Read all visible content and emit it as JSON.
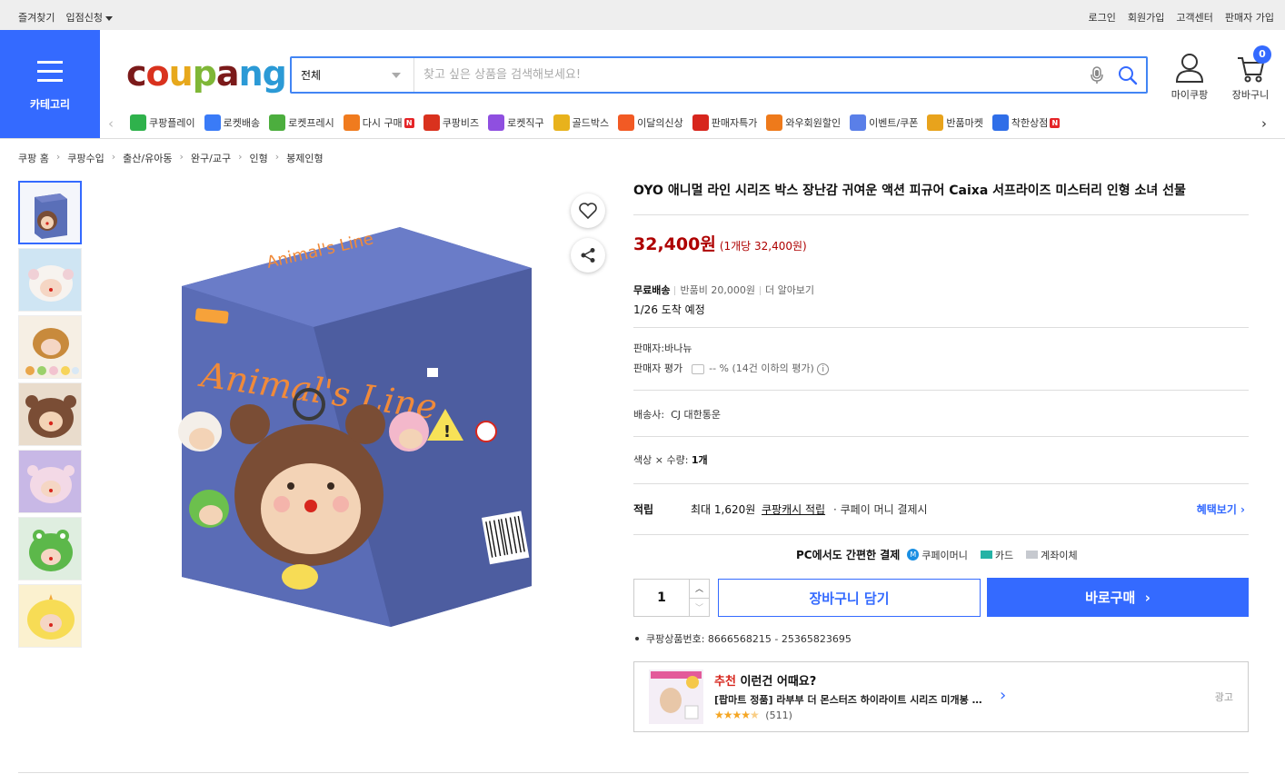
{
  "topbar": {
    "left": [
      "즐겨찾기",
      "입점신청"
    ],
    "right": [
      "로그인",
      "회원가입",
      "고객센터",
      "판매자 가입"
    ]
  },
  "header": {
    "category_label": "카테고리",
    "logo_text": "coupang",
    "search_category": "전체",
    "search_placeholder": "찾고 싶은 상품을 검색해보세요!",
    "mycoupang_label": "마이쿠팡",
    "cart_label": "장바구니",
    "cart_count": "0"
  },
  "catnav": [
    {
      "label": "쿠팡플레이",
      "icon": "play-icon",
      "color": "#2fb24c"
    },
    {
      "label": "로켓배송",
      "icon": "rocket-icon",
      "color": "#3a7bf7"
    },
    {
      "label": "로켓프레시",
      "icon": "rocket-fresh-icon",
      "color": "#4cae3e"
    },
    {
      "label": "다시 구매",
      "icon": "basket-icon",
      "color": "#f07b1e",
      "badge": "N"
    },
    {
      "label": "쿠팡비즈",
      "icon": "biz-icon",
      "color": "#d9321e"
    },
    {
      "label": "로켓직구",
      "icon": "rocket-global-icon",
      "color": "#8f4fe0"
    },
    {
      "label": "골드박스",
      "icon": "goldbox-icon",
      "color": "#e8b21c"
    },
    {
      "label": "이달의신상",
      "icon": "new-bag-icon",
      "color": "#f25a24"
    },
    {
      "label": "판매자특가",
      "icon": "percent-icon",
      "color": "#d7261d"
    },
    {
      "label": "와우회원할인",
      "icon": "wow-icon",
      "color": "#ee7a1b"
    },
    {
      "label": "이벤트/쿠폰",
      "icon": "coupon-icon",
      "color": "#5a7fe8"
    },
    {
      "label": "반품마켓",
      "icon": "return-market-icon",
      "color": "#e8a31c"
    },
    {
      "label": "착한상점",
      "icon": "store-icon",
      "color": "#2f6ee8",
      "badge": "N"
    }
  ],
  "breadcrumb": [
    "쿠팡 홈",
    "쿠팡수입",
    "출산/유아동",
    "완구/교구",
    "인형",
    "봉제인형"
  ],
  "product": {
    "title": "OYO 애니멀 라인 시리즈 박스 장난감 귀여운 액션 피규어 Caixa 서프라이즈 미스터리 인형 소녀 선물",
    "price": "32,400원",
    "unit_price": "(1개당 32,400원)",
    "shipping": {
      "free": "무료배송",
      "return_fee": "반품비 20,000원",
      "more": "더 알아보기",
      "arrival": "1/26 도착 예정"
    },
    "seller": {
      "label": "판매자:",
      "name": "바나뉴",
      "rating_label": "판매자 평가",
      "rating_value": "-- %",
      "rating_note": "(14건 이하의 평가)"
    },
    "carrier": {
      "label": "배송사:",
      "name": "CJ 대한통운"
    },
    "option": {
      "label": "색상 × 수량:",
      "value": "1개"
    },
    "points": {
      "label": "적립",
      "max": "최대 1,620원",
      "cash": "쿠팡캐시 적립",
      "cond": "· 쿠페이 머니 결제시",
      "benefit": "혜택보기"
    },
    "payment": {
      "title": "PC에서도 간편한 결제",
      "coupay": "쿠페이머니",
      "card": "카드",
      "bank": "계좌이체"
    },
    "quantity": "1",
    "cart_button": "장바구니 담기",
    "buy_button": "바로구매",
    "product_no": "쿠팡상품번호: 8666568215 - 25365823695"
  },
  "reco": {
    "label_red": "추천",
    "label_rest": "이런건 어때요?",
    "title": "[팝마트 정품] 라부부 더 몬스터즈 하이라이트 시리즈 미개봉 …",
    "reviews": "(511)",
    "rating": 4.5,
    "ad": "광고"
  },
  "colors": {
    "brand_blue": "#346aff",
    "price_red": "#ae0000"
  }
}
